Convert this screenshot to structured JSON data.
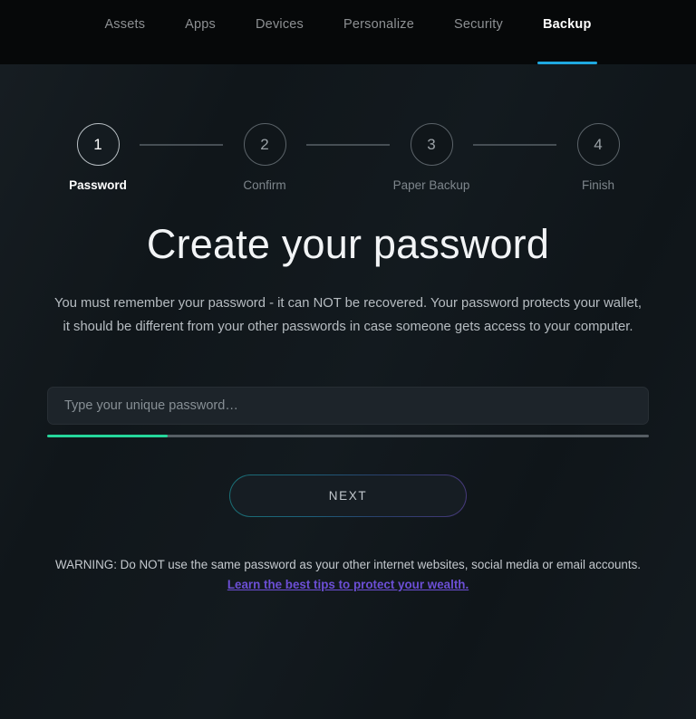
{
  "nav": {
    "tabs": [
      {
        "label": "Assets",
        "active": false
      },
      {
        "label": "Apps",
        "active": false
      },
      {
        "label": "Devices",
        "active": false
      },
      {
        "label": "Personalize",
        "active": false
      },
      {
        "label": "Security",
        "active": false
      },
      {
        "label": "Backup",
        "active": true
      }
    ],
    "active_underline_color": "#1fa8e0"
  },
  "stepper": {
    "current_step": 1,
    "steps": [
      {
        "number": "1",
        "label": "Password",
        "active": true
      },
      {
        "number": "2",
        "label": "Confirm",
        "active": false
      },
      {
        "number": "3",
        "label": "Paper Backup",
        "active": false
      },
      {
        "number": "4",
        "label": "Finish",
        "active": false
      }
    ]
  },
  "main": {
    "title": "Create your password",
    "description": "You must remember your password - it can NOT be recovered. Your password protects your wallet, it should be different from your other passwords in case someone gets access to your computer.",
    "password_field": {
      "value": "",
      "placeholder": "Type your unique password…",
      "strength_percent": 20,
      "strength_color": "#25d69b"
    },
    "next_button": "NEXT"
  },
  "footer": {
    "warning": "WARNING: Do NOT use the same password as your other internet websites, social media or email accounts.",
    "link": "Learn the best tips to protect your wealth.",
    "link_color": "#6c4fd6"
  }
}
